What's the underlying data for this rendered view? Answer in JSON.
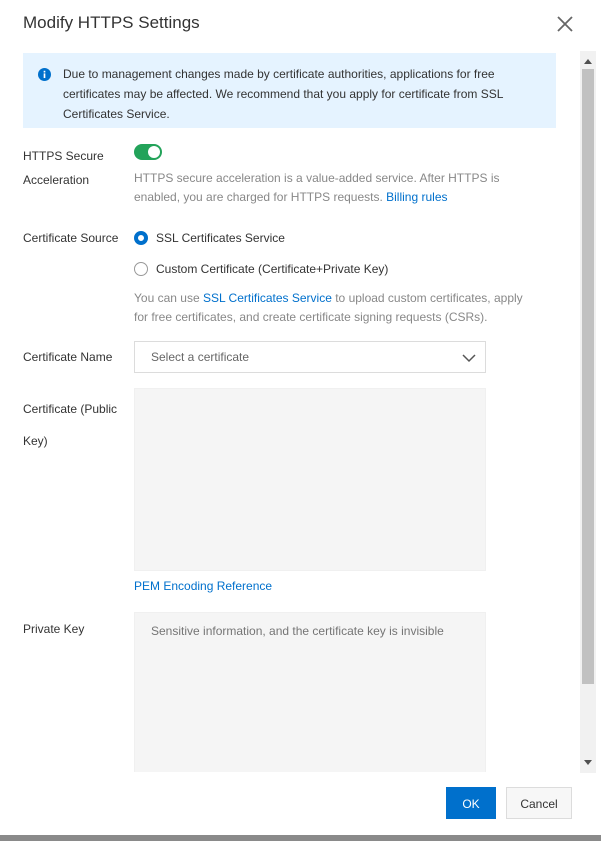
{
  "dialog": {
    "title": "Modify HTTPS Settings"
  },
  "alert": {
    "text": "Due to management changes made by certificate authorities, applications for free certificates may be affected. We recommend that you apply for certificate from SSL Certificates Service."
  },
  "https_secure": {
    "label_line1": "HTTPS Secure",
    "label_line2": "Acceleration",
    "enabled": true,
    "help_text": "HTTPS secure acceleration is a value-added service. After HTTPS is enabled, you are charged for HTTPS requests. ",
    "billing_link": "Billing rules"
  },
  "certificate_source": {
    "label": "Certificate Source",
    "options": [
      {
        "label": "SSL Certificates Service",
        "checked": true
      },
      {
        "label": "Custom Certificate (Certificate+Private Key)",
        "checked": false
      }
    ],
    "help_prefix": "You can use ",
    "help_link": "SSL Certificates Service",
    "help_suffix": " to upload custom certificates, apply for free certificates, and create certificate signing requests (CSRs)."
  },
  "certificate_name": {
    "label": "Certificate Name",
    "placeholder": "Select a certificate"
  },
  "certificate_public_key": {
    "label_line1": "Certificate (Public",
    "label_line2": "Key)",
    "value": "",
    "pem_link": "PEM Encoding Reference"
  },
  "private_key": {
    "label": "Private Key",
    "placeholder": "Sensitive information, and the certificate key is invisible"
  },
  "footer": {
    "ok_label": "OK",
    "cancel_label": "Cancel"
  },
  "colors": {
    "primary": "#0070cc",
    "switch_on": "#23a35a",
    "alert_bg": "#e5f3ff"
  }
}
